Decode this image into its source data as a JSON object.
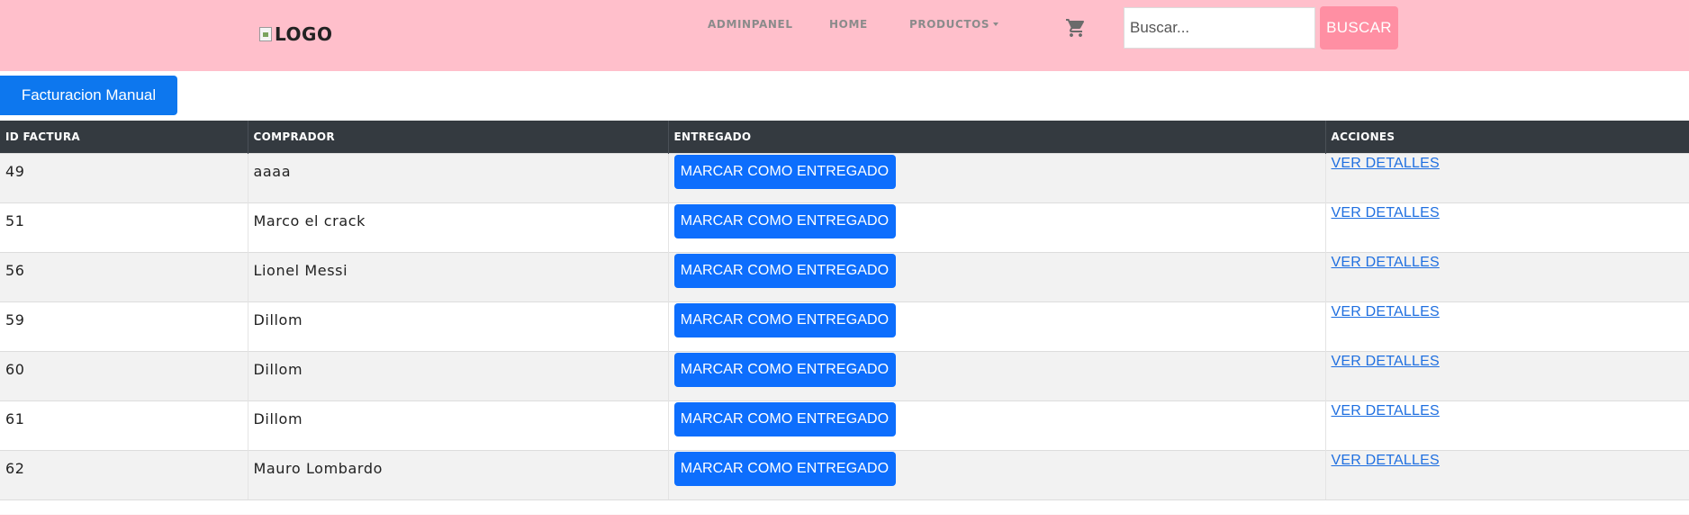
{
  "navbar": {
    "logo_alt": "LOGO",
    "links": [
      "ADMINPANEL",
      "HOME",
      "PRODUCTOS"
    ],
    "cart_icon": "shopping-cart-icon",
    "search_placeholder": "Buscar...",
    "search_button": "BUSCAR",
    "bg_color": "#ffbfcb"
  },
  "actions": {
    "manual_button": "Facturacion Manual"
  },
  "table": {
    "headers": [
      "ID FACTURA",
      "COMPRADOR",
      "ENTREGADO",
      "ACCIONES"
    ],
    "rows": [
      {
        "id": "49",
        "comprador": "aaaa",
        "entregado_label": "MARCAR COMO ENTREGADO",
        "accion_label": "VER DETALLES"
      },
      {
        "id": "51",
        "comprador": "Marco el crack",
        "entregado_label": "MARCAR COMO ENTREGADO",
        "accion_label": "VER DETALLES"
      },
      {
        "id": "56",
        "comprador": "Lionel Messi",
        "entregado_label": "MARCAR COMO ENTREGADO",
        "accion_label": "VER DETALLES"
      },
      {
        "id": "59",
        "comprador": "Dillom",
        "entregado_label": "MARCAR COMO ENTREGADO",
        "accion_label": "VER DETALLES"
      },
      {
        "id": "60",
        "comprador": "Dillom",
        "entregado_label": "MARCAR COMO ENTREGADO",
        "accion_label": "VER DETALLES"
      },
      {
        "id": "61",
        "comprador": "Dillom",
        "entregado_label": "MARCAR COMO ENTREGADO",
        "accion_label": "VER DETALLES"
      },
      {
        "id": "62",
        "comprador": "Mauro Lombardo",
        "entregado_label": "MARCAR COMO ENTREGADO",
        "accion_label": "VER DETALLES"
      }
    ]
  },
  "colors": {
    "primary_button": "#0d6efd",
    "search_button": "#ff8fa3",
    "table_header": "#343a40"
  }
}
